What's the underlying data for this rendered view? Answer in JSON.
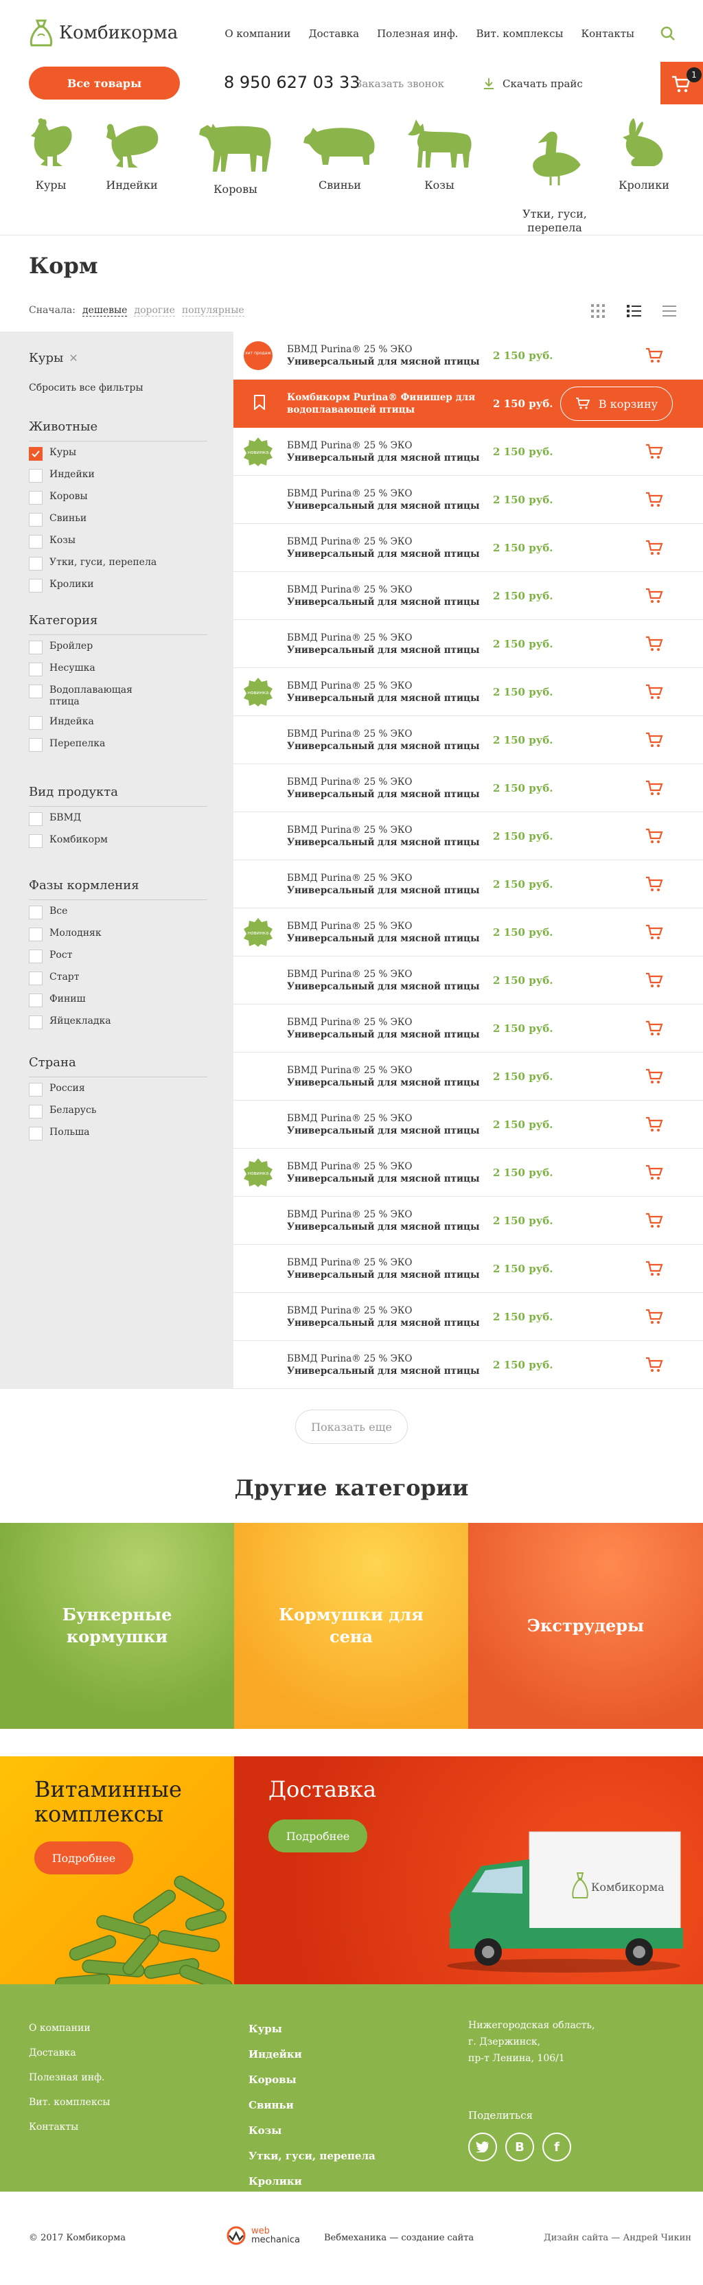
{
  "header": {
    "logo_text": "Комбикорма",
    "nav": [
      "О компании",
      "Доставка",
      "Полезная инф.",
      "Вит. комплексы",
      "Контакты"
    ],
    "all_goods": "Все товары",
    "phone": "8 950 627 03 33",
    "callback": "Заказать звонок",
    "download_price": "Скачать прайс",
    "cart_count": "1",
    "accent": "#f05a28",
    "green": "#8bb54a"
  },
  "animals": [
    "Куры",
    "Индейки",
    "Коровы",
    "Свиньи",
    "Козы",
    "Утки, гуси,\nперепела",
    "Кролики"
  ],
  "page_title": "Корм",
  "sort": {
    "label": "Сначала:",
    "options": [
      "дешевые",
      "дорогие",
      "популярные"
    ]
  },
  "sidebar": {
    "selected": "Куры",
    "reset": "Сбросить все фильтры",
    "sections": [
      {
        "title": "Животные",
        "options": [
          "Куры",
          "Индейки",
          "Коровы",
          "Свиньи",
          "Козы",
          "Утки, гуси, перепела",
          "Кролики"
        ]
      },
      {
        "title": "Категория",
        "options": [
          "Бройлер",
          "Несушка",
          "Водоплавающая птица",
          "Индейка",
          "Перепелка"
        ]
      },
      {
        "title": "Вид продукта",
        "options": [
          "БВМД",
          "Комбикорм"
        ]
      },
      {
        "title": "Фазы кормления",
        "options": [
          "Все",
          "Молодняк",
          "Рост",
          "Старт",
          "Финиш",
          "Яйцекладка"
        ]
      },
      {
        "title": "Страна",
        "options": [
          "Россия",
          "Беларусь",
          "Польша"
        ]
      }
    ]
  },
  "products": {
    "name_line1": "БВМД Purina® 25 % ЭКО",
    "name_line2": "Универсальный для мясной птицы",
    "price": "2 150 руб.",
    "highlight_line1": "Комбикорм Purina® Финишер для",
    "highlight_line2": "водоплавающей птицы",
    "to_cart": "В корзину",
    "badge_text": "новинка",
    "badge_text_top": "хит продаж"
  },
  "show_more": "Показать еще",
  "other_title": "Другие категории",
  "categories": [
    "Бункерные\nкормушки",
    "Кормушки для\nсена",
    "Экструдеры"
  ],
  "promos": {
    "vitamins_title": "Витаминные\nкомплексы",
    "delivery_title": "Доставка",
    "more": "Подробнее",
    "truck_brand": "Комбикорма"
  },
  "footer": {
    "links": [
      "О компании",
      "Доставка",
      "Полезная инф.",
      "Вит. комплексы",
      "Контакты"
    ],
    "animals": [
      "Куры",
      "Индейки",
      "Коровы",
      "Свиньи",
      "Козы",
      "Утки, гуси, перепела",
      "Кролики"
    ],
    "address": "Нижегородская область,\nг. Дзержинск,\nпр-т Ленина, 106/1",
    "share": "Поделиться",
    "copyright": "© 2017 Комбикорма",
    "dev_logo_line1": "web",
    "dev_logo_line2": "mechanica",
    "dev_text": "Вебмеханика — создание сайта",
    "design": "Дизайн сайта — Андрей Чикин"
  }
}
